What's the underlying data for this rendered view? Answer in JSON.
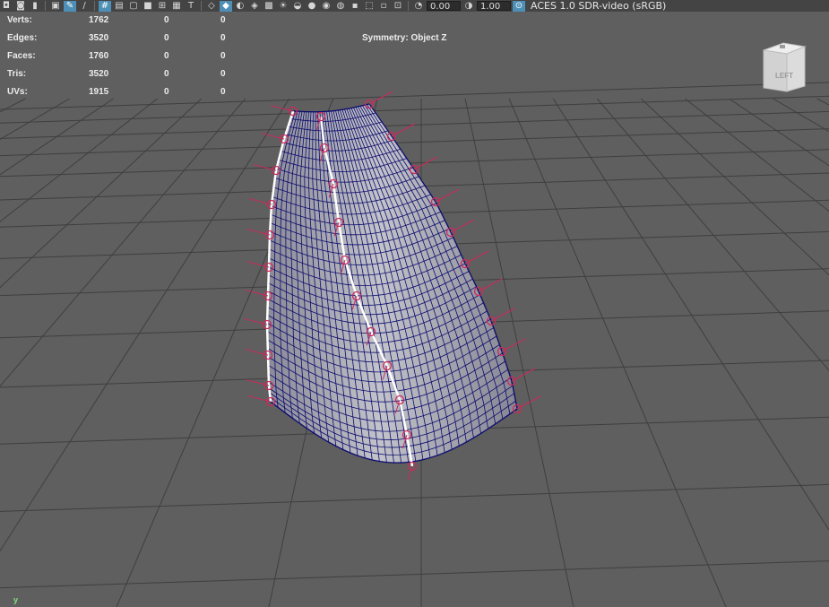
{
  "toolbar": {
    "icons": [
      "camera-icon",
      "camera-attr-icon",
      "bookmark-icon",
      "image-plane-icon",
      "grease-pencil-icon",
      "grid-icon",
      "film-gate-icon",
      "resolution-gate-icon",
      "gate-mask-icon",
      "field-chart-icon",
      "safe-action-icon",
      "safe-title-icon",
      "pan-zoom-icon",
      "wireframe-icon",
      "smooth-shade-icon",
      "default-material-icon",
      "xray-active-icon",
      "textured-icon",
      "lights-icon",
      "shadows-icon",
      "ambient-occlusion-icon",
      "motion-blur-icon",
      "anti-alias-icon",
      "depth-of-field-icon",
      "isolate-select-icon",
      "xray-icon",
      "xray-joints-icon",
      "backface-icon",
      "exposure-icon",
      "gamma-icon",
      "color-management-icon"
    ],
    "exposure_value": "0.00",
    "gamma_value": "1.00",
    "color_space": "ACES 1.0 SDR-video (sRGB)"
  },
  "hud": {
    "rows": [
      {
        "label": "Verts:",
        "values": [
          "1762",
          "0",
          "0"
        ]
      },
      {
        "label": "Edges:",
        "values": [
          "3520",
          "0",
          "0"
        ]
      },
      {
        "label": "Faces:",
        "values": [
          "1760",
          "0",
          "0"
        ]
      },
      {
        "label": "Tris:",
        "values": [
          "3520",
          "0",
          "0"
        ]
      },
      {
        "label": "UVs:",
        "values": [
          "1915",
          "0",
          "0"
        ]
      }
    ]
  },
  "symmetry": "Symmetry: Object Z",
  "viewcube": {
    "face_label": "LEFT"
  },
  "axis_indicator": "y",
  "colors": {
    "viewport_bg": "#5f5f5f",
    "grid_line": "#3f3f3f",
    "mesh_wire": "#0b0b6e",
    "mesh_fill": "#a9a9b2",
    "selection_highlight": "#ffffff",
    "manipulator_pink": "#cc2a5c",
    "toolbar_bg": "#444444",
    "toolbar_active": "#4d8fb6"
  }
}
